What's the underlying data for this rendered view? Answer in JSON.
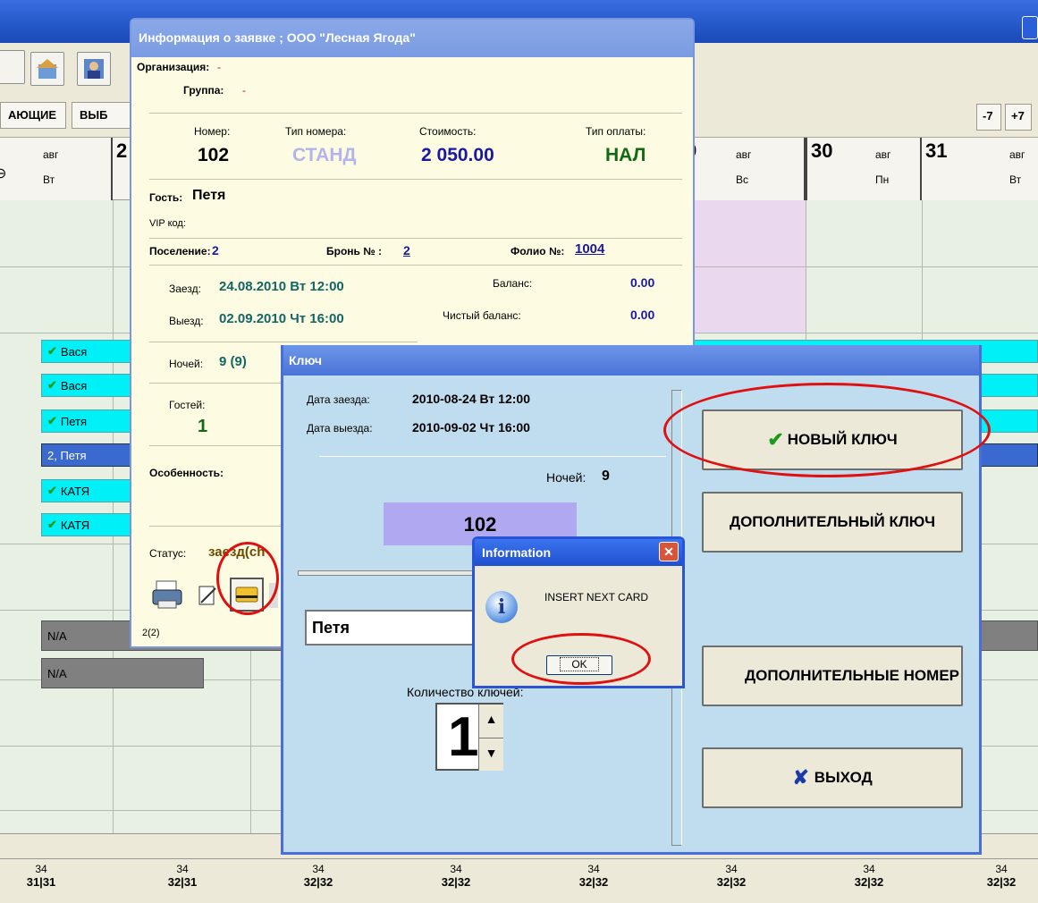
{
  "toolbar": {
    "btn_prev7": "-7",
    "btn_next7": "+7",
    "tab1": "АЮЩИЕ",
    "tab2": "ВЫБ"
  },
  "calendar": {
    "days": [
      {
        "num": "",
        "month": "авг",
        "weekday": "Вт"
      },
      {
        "num": "2",
        "month": "",
        "weekday": ""
      },
      {
        "num": "9",
        "month": "авг",
        "weekday": "Вс"
      },
      {
        "num": "30",
        "month": "авг",
        "weekday": "Пн"
      },
      {
        "num": "31",
        "month": "авг",
        "weekday": "Вт"
      }
    ]
  },
  "reservations": [
    {
      "label": "Вася"
    },
    {
      "label": "Вася"
    },
    {
      "label": "Петя"
    },
    {
      "label": "2, Петя"
    },
    {
      "label": "КАТЯ"
    },
    {
      "label": "КАТЯ"
    },
    {
      "label": "N/A"
    },
    {
      "label": "N/A"
    }
  ],
  "footer": [
    {
      "top": "34",
      "bottom": "31|31"
    },
    {
      "top": "34",
      "bottom": "32|31"
    },
    {
      "top": "34",
      "bottom": "32|32"
    },
    {
      "top": "34",
      "bottom": "32|32"
    },
    {
      "top": "34",
      "bottom": "32|32"
    },
    {
      "top": "34",
      "bottom": "32|32"
    },
    {
      "top": "34",
      "bottom": "32|32"
    },
    {
      "top": "34",
      "bottom": "32|32"
    }
  ],
  "info_window": {
    "title": "Информация о заявке ; ООО \"Лесная Ягода\"",
    "org_label": "Организация:",
    "org_value": "-",
    "group_label": "Группа:",
    "group_value": "-",
    "room_label": "Номер:",
    "room_value": "102",
    "room_type_label": "Тип номера:",
    "room_type_value": "СТАНД",
    "cost_label": "Стоимость:",
    "cost_value": "2 050.00",
    "pay_label": "Тип оплаты:",
    "pay_value": "НАЛ",
    "guest_label": "Гость:",
    "guest_value": "Петя",
    "vip_label": "VIP код:",
    "settle_label": "Поселение:",
    "settle_value": "2",
    "booking_label": "Бронь № :",
    "booking_value": "2",
    "folio_label": "Фолио №:",
    "folio_value": "1004",
    "checkin_label": "Заезд:",
    "checkin_value": "24.08.2010 Вт 12:00",
    "checkout_label": "Выезд:",
    "checkout_value": "02.09.2010 Чт 16:00",
    "balance_label": "Баланс:",
    "balance_value": "0.00",
    "net_balance_label": "Чистый баланс:",
    "net_balance_value": "0.00",
    "nights_label": "Ночей:",
    "nights_value": "9 (9)",
    "guests_label": "Гостей:",
    "guests_value": "1",
    "feature_label": "Особенность:",
    "status_label": "Статус:",
    "status_value": "заезд(ch",
    "page_info": "2(2)"
  },
  "key_dialog": {
    "title": "Ключ",
    "checkin_label": "Дата заезда:",
    "checkin_value": "2010-08-24 Вт  12:00",
    "checkout_label": "Дата выезда:",
    "checkout_value": "2010-09-02 Чт  16:00",
    "nights_label": "Ночей:",
    "nights_value": "9",
    "room": "102",
    "guest_field": "Петя",
    "count_label": "Количество ключей:",
    "count_value": "1",
    "btn_new_key": "НОВЫЙ КЛЮЧ",
    "btn_extra_key": "ДОПОЛНИТЕЛЬНЫЙ КЛЮЧ",
    "btn_extra_rooms": "ДОПОЛНИТЕЛЬНЫЕ НОМЕР",
    "btn_exit": "ВЫХОД"
  },
  "message_box": {
    "title": "Information",
    "text": "INSERT NEXT CARD",
    "ok": "OK"
  },
  "colors": {
    "title_blue": "#4a74d8",
    "reservation_cyan": "#00f0f8",
    "reservation_selected": "#3a6ad0",
    "annotation_red": "#e01010"
  }
}
